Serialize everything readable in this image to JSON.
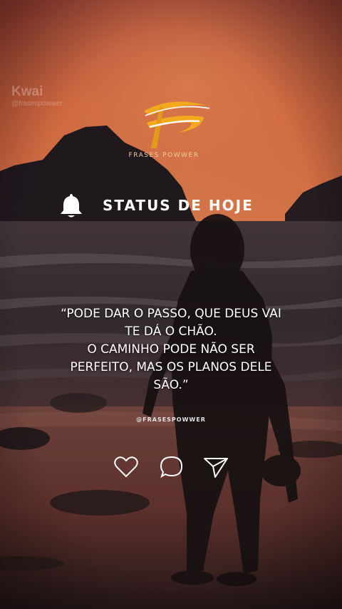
{
  "watermark": {
    "brand": "Kwai",
    "sub": "@frasespowwer"
  },
  "logo": {
    "caption": "FRASES POWWER"
  },
  "status": {
    "title": "STATUS DE HOJE",
    "icon": "bell-icon"
  },
  "quote": {
    "lines": [
      "“PODE DAR O PASSO, QUE DEUS VAI",
      "TE DÁ O CHÃO.",
      "O CAMINHO PODE NÃO SER",
      "PERFEITO, MAS OS PLANOS DELE",
      "SÃO.”"
    ]
  },
  "handle": "@FRASESPOWWER",
  "actions": [
    {
      "icon": "heart-icon"
    },
    {
      "icon": "comment-icon"
    },
    {
      "icon": "send-icon"
    }
  ],
  "colors": {
    "sky_top": "#c9533f",
    "sky_glow": "#ef7a4a",
    "sea": "#2f2a30",
    "sand": "#6b3b35",
    "logo_gold": "#f2a91e"
  }
}
